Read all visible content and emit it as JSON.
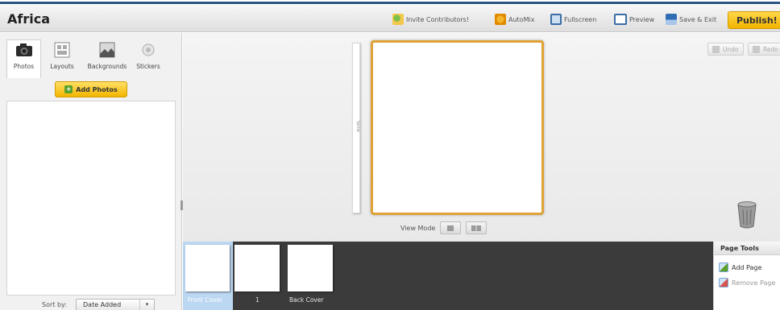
{
  "header": {
    "title": "Africa",
    "invite_label": "Invite Contributors!",
    "automix_label": "AutoMix",
    "fullscreen_label": "Fullscreen",
    "preview_label": "Preview",
    "save_exit_label": "Save & Exit",
    "publish_label": "Publish!"
  },
  "left_panel": {
    "tabs": [
      {
        "label": "Photos",
        "icon": "camera-icon",
        "active": true
      },
      {
        "label": "Layouts",
        "icon": "layouts-icon",
        "active": false
      },
      {
        "label": "Backgrounds",
        "icon": "backgrounds-icon",
        "active": false
      },
      {
        "label": "Stickers",
        "icon": "stickers-icon",
        "active": false
      }
    ],
    "add_photos_label": "Add Photos",
    "sort_label": "Sort by:",
    "sort_value": "Date Added"
  },
  "workspace": {
    "undo_label": "Undo",
    "redo_label": "Redo",
    "view_label": "View Mode",
    "spine_text": "Spine"
  },
  "filmstrip": {
    "pages": [
      {
        "label": "Front Cover",
        "selected": true
      },
      {
        "label": "1",
        "selected": false
      },
      {
        "label": "Back Cover",
        "selected": false
      }
    ]
  },
  "page_tools": {
    "title": "Page Tools",
    "add_page_label": "Add Page",
    "remove_page_label": "Remove Page"
  },
  "colors": {
    "accent_yellow": "#f1b300",
    "canvas_border": "#e0a236",
    "header_blue": "#1f4a78",
    "filmstrip_bg": "#3b3b3b",
    "selected_thumb": "#bcd7f2"
  }
}
